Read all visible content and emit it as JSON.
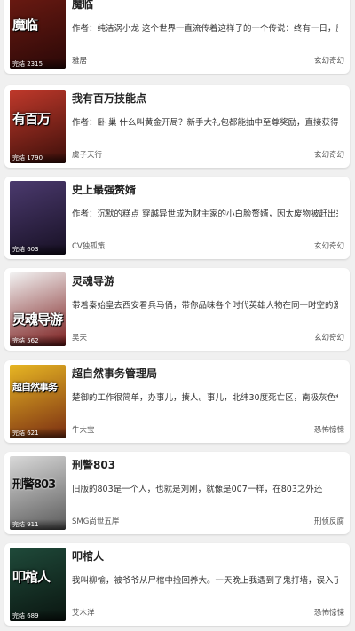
{
  "books": [
    {
      "title": "魔临",
      "description": "作者：纯洁涡小龙 这个世界一直流传着这样子的一个传说：终有一日，魔",
      "author": "雅居",
      "genre": "玄幻奇幻",
      "cover_text": "魔临",
      "badge": "完结 2315",
      "cover_colors": [
        "#6b1a12",
        "#2a0807"
      ]
    },
    {
      "title": "我有百万技能点",
      "description": "作者：卧 巢 什么叫黄金开局？新手大礼包都能抽中至尊奖励，直接获得",
      "author": "虞子天行",
      "genre": "玄幻奇幻",
      "cover_text": "有百万",
      "badge": "完结 1790",
      "cover_colors": [
        "#c0392b",
        "#3d0f0a"
      ]
    },
    {
      "title": "史上最强赘婿",
      "description": "作者：沉默的糕点 穿越异世成为财主家的小白脸赘婿，因太废物被赶出来",
      "author": "CV独孤策",
      "genre": "玄幻奇幻",
      "cover_text": "",
      "badge": "完结 603",
      "cover_colors": [
        "#4b3a6e",
        "#171024"
      ]
    },
    {
      "title": "灵魂导游",
      "description": "带着秦始皇去西安看兵马俑，带你品味各个时代英雄人物在同一时空的激情",
      "author": "吴天",
      "genre": "玄幻奇幻",
      "cover_text": "灵魂导游",
      "badge": "完结 562",
      "cover_colors": [
        "#f2f2f2",
        "#7a1c1c"
      ]
    },
    {
      "title": "超自然事务管理局",
      "description": "楚御的工作很简单，办事儿，揍人。事儿，北纬30度死亡区，南极灰色*",
      "author": "牛大宝",
      "genre": "恐怖惊悚",
      "cover_text": "超自然事务",
      "badge": "完结 621",
      "cover_colors": [
        "#e7b623",
        "#7a2d12"
      ]
    },
    {
      "title": "刑警803",
      "description": "旧版的803是一个人，也就是刘刚，就像是007一样，在803之外还",
      "author": "SMG尚世五岸",
      "genre": "刑侦反腐",
      "cover_text": "刑警803",
      "badge": "完结 911",
      "cover_colors": [
        "#d9d9d9",
        "#5a5a5a"
      ]
    },
    {
      "title": "叩棺人",
      "description": "我叫柳愉，被爷爷从尸棺中捡回养大。一天晚上我遇到了鬼打墙，误入了",
      "author": "艾木洋",
      "genre": "恐怖惊悚",
      "cover_text": "叩棺人",
      "badge": "完结 689",
      "cover_colors": [
        "#1f4a3a",
        "#0a1510"
      ]
    }
  ]
}
